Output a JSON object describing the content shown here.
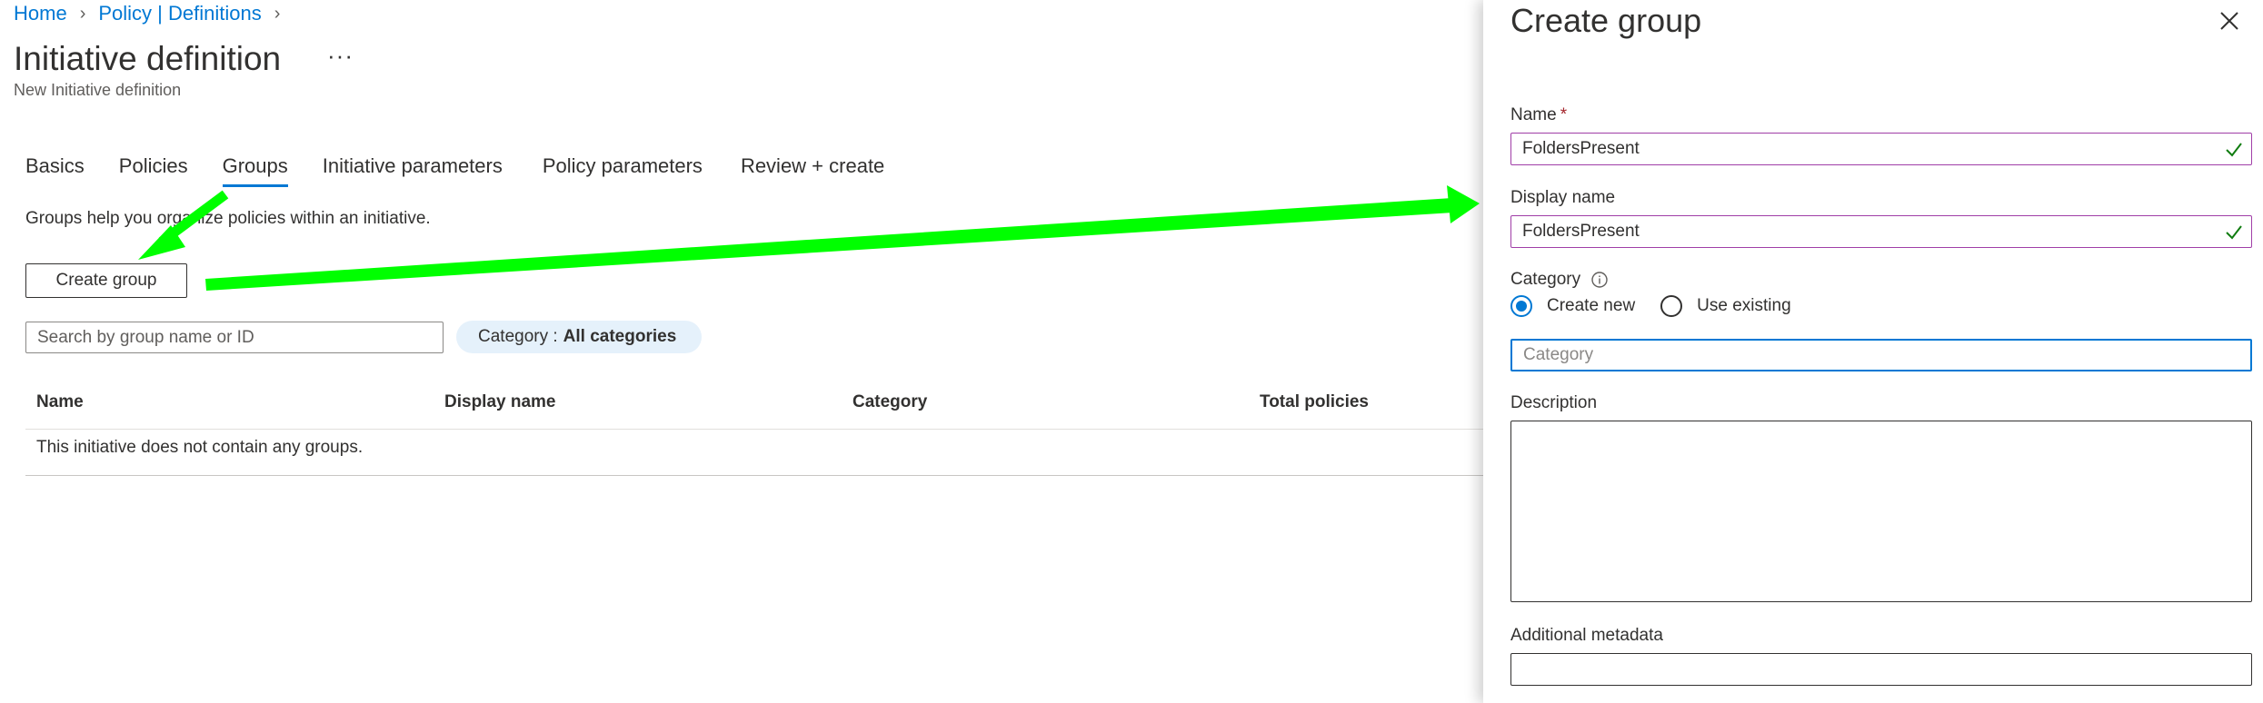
{
  "breadcrumb": {
    "home": "Home",
    "policy": "Policy | Definitions"
  },
  "page": {
    "title": "Initiative definition",
    "subtitle": "New Initiative definition",
    "more": "···"
  },
  "tabs": [
    {
      "label": "Basics"
    },
    {
      "label": "Policies"
    },
    {
      "label": "Groups",
      "active": true
    },
    {
      "label": "Initiative parameters"
    },
    {
      "label": "Policy parameters"
    },
    {
      "label": "Review + create"
    }
  ],
  "groups": {
    "intro": "Groups help you organize policies within an initiative.",
    "create_button": "Create group",
    "search_placeholder": "Search by group name or ID",
    "filter_label": "Category :",
    "filter_value": "All categories",
    "columns": [
      "Name",
      "Display name",
      "Category",
      "Total policies"
    ],
    "empty_message": "This initiative does not contain any groups."
  },
  "panel": {
    "title": "Create group",
    "name_label": "Name",
    "required_mark": "*",
    "name_value": "FoldersPresent",
    "display_name_label": "Display name",
    "display_name_value": "FoldersPresent",
    "category_label": "Category",
    "radio_create_new": "Create new",
    "radio_use_existing": "Use existing",
    "category_placeholder": "Category",
    "description_label": "Description",
    "metadata_label": "Additional metadata"
  },
  "colors": {
    "accent": "#0078d4",
    "annotation_arrow": "#00ff00",
    "validated_border": "#a03ea7",
    "check": "#107c10"
  },
  "icons": [
    "chevron-right-icon",
    "more-icon",
    "close-icon",
    "checkmark-icon",
    "info-icon"
  ]
}
